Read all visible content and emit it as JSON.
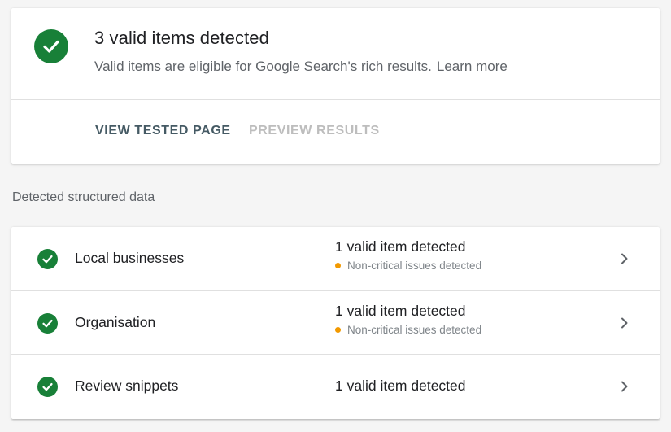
{
  "summary": {
    "title": "3 valid items detected",
    "subtitle": "Valid items are eligible for Google Search's rich results.",
    "learn_more": "Learn more",
    "status_icon": "check-circle-icon",
    "accent_color": "#188038"
  },
  "actions": {
    "view_tested_page": "VIEW TESTED PAGE",
    "preview_results": "PREVIEW RESULTS",
    "preview_results_disabled": true
  },
  "section_label": "Detected structured data",
  "items": [
    {
      "name": "Local businesses",
      "status": "1 valid item detected",
      "note": "Non-critical issues detected"
    },
    {
      "name": "Organisation",
      "status": "1 valid item detected",
      "note": "Non-critical issues detected"
    },
    {
      "name": "Review snippets",
      "status": "1 valid item detected",
      "note": ""
    }
  ],
  "colors": {
    "valid": "#188038",
    "warning": "#f29900"
  }
}
